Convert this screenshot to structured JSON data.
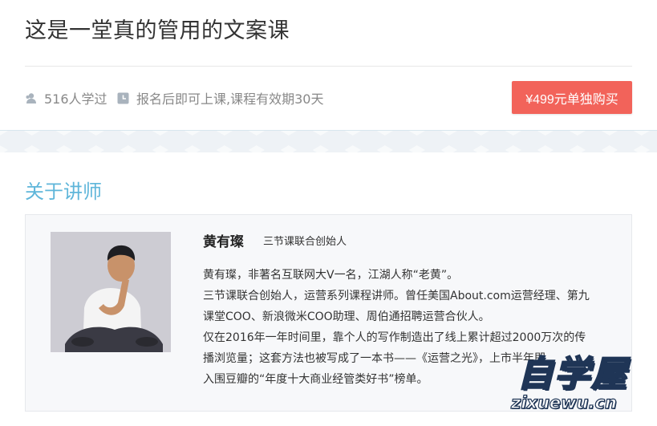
{
  "course": {
    "title": "这是一堂真的管用的文案课",
    "students": "516人学过",
    "validity": "报名后即可上课,课程有效期30天",
    "buy_button": "¥499元单独购买"
  },
  "teacher_section": {
    "heading": "关于讲师",
    "name": "黄有璨",
    "role": "三节课联合创始人",
    "bio": [
      "黄有璨，非著名互联网大V一名，江湖人称“老黄”。",
      "三节课联合创始人，运营系列课程讲师。曾任美国About.com运营经理、第九",
      "课堂COO、新浪微米COO助理、周伯通招聘运营合伙人。",
      "仅在2016年一年时间里，靠个人的写作制造出了线上累计超过2000万次的传",
      "播浏览量；这套方法也被写成了一本书——《运营之光》，上市半年即",
      "入围豆瓣的“年度十大商业经管类好书”榜单。"
    ]
  },
  "watermark": {
    "logo": "自学屋",
    "url": "zixuewu.cn"
  },
  "colors": {
    "accent": "#5fb6da",
    "buy": "#f2635a"
  }
}
